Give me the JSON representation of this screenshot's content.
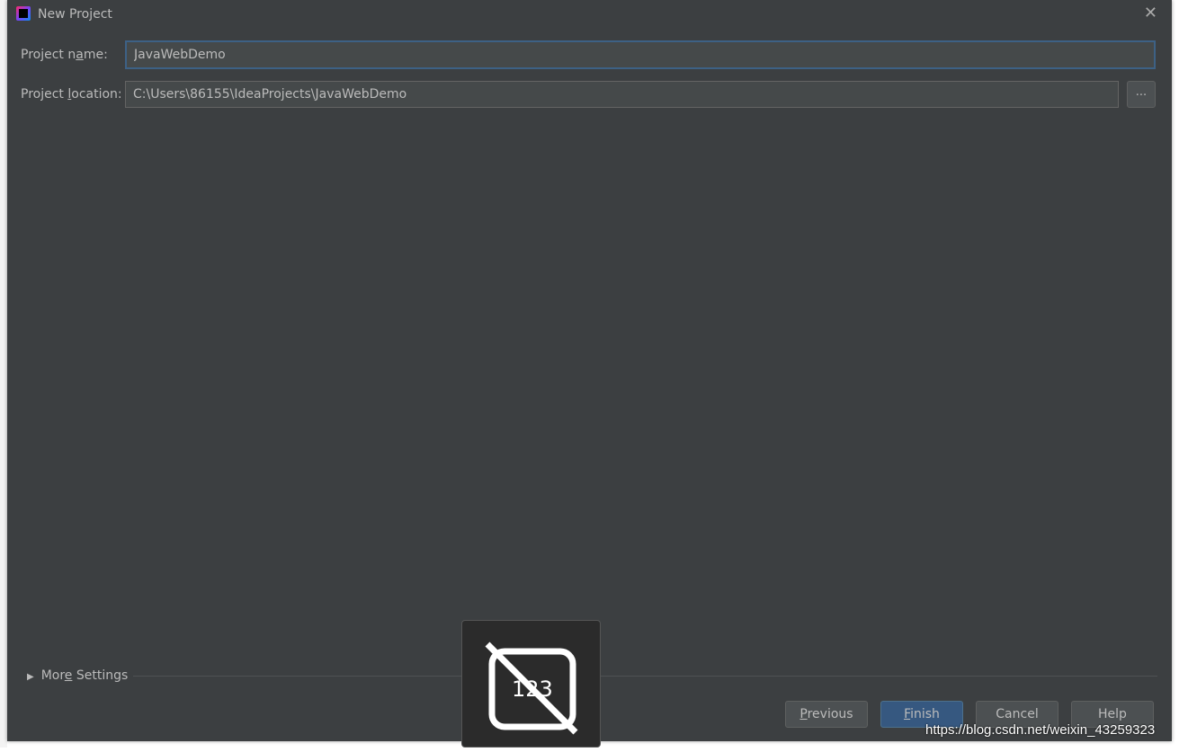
{
  "dialog": {
    "title": "New Project",
    "logo_icon": "intellij-idea-icon",
    "close_icon": "close-icon"
  },
  "form": {
    "name_label_pre": "Project n",
    "name_label_u": "a",
    "name_label_post": "me:",
    "name_value": "JavaWebDemo",
    "location_label_pre": "Project ",
    "location_label_u": "l",
    "location_label_post": "ocation:",
    "location_value": "C:\\Users\\86155\\IdeaProjects\\JavaWebDemo",
    "browse_label": "..."
  },
  "more_settings": {
    "pre": "Mor",
    "u": "e",
    "post": " Settings"
  },
  "buttons": {
    "previous_u": "P",
    "previous_rest": "revious",
    "finish_u": "F",
    "finish_rest": "inish",
    "cancel": "Cancel",
    "help": "Help"
  },
  "overlay": {
    "icon": "numeric-input-disabled-icon",
    "text": "123"
  },
  "watermark": "https://blog.csdn.net/weixin_43259323",
  "colors": {
    "background": "#3c3f41",
    "focus_border": "#3d6185",
    "primary_button": "#365880"
  }
}
